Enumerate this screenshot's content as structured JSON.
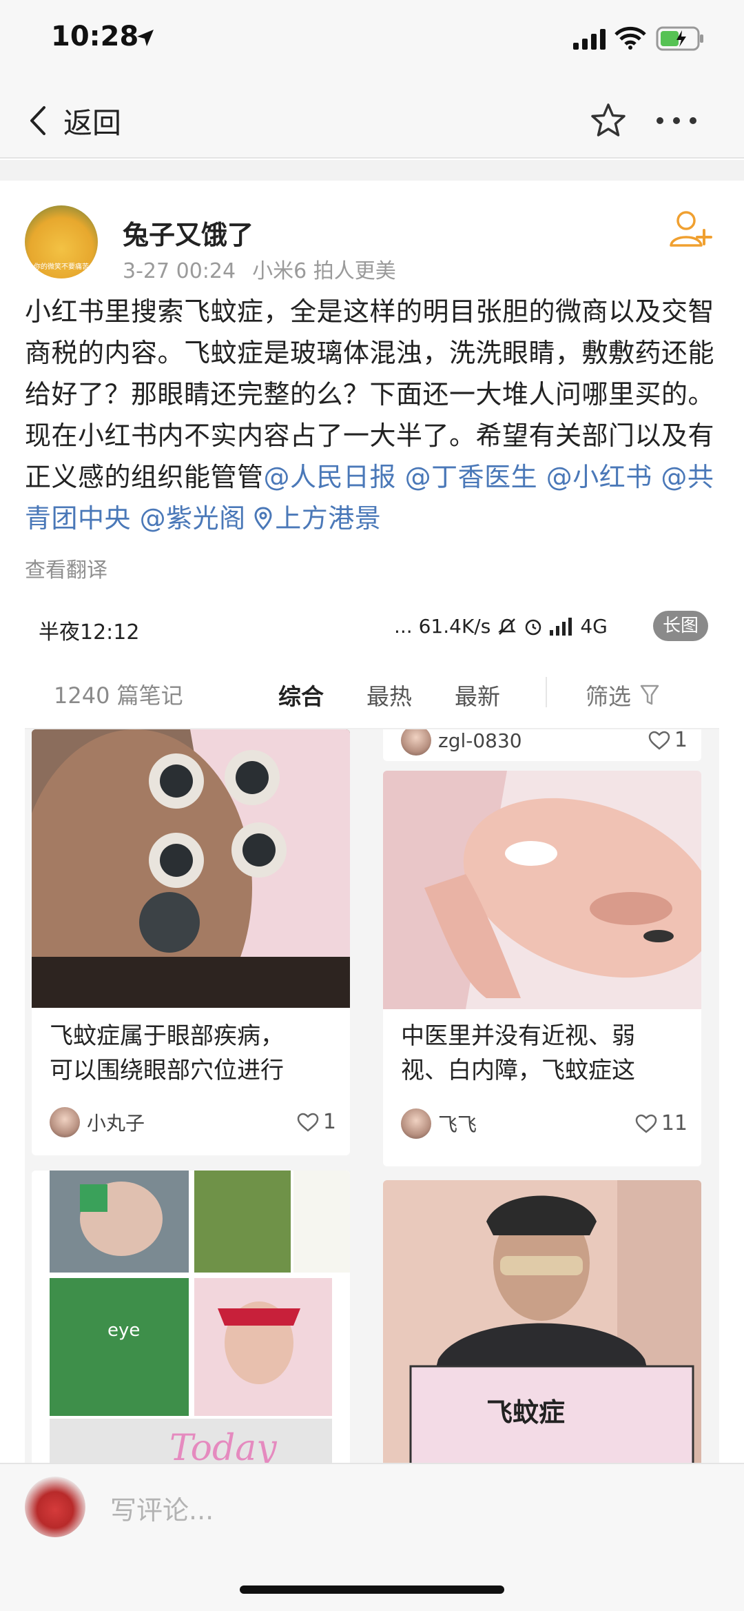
{
  "status_bar": {
    "time": "10:28"
  },
  "nav": {
    "back_label": "返回"
  },
  "post": {
    "username": "兔子又饿了",
    "avatar_caption": "你的微笑不要痛苦",
    "date": "3-27 00:24",
    "device": "小米6 拍人更美",
    "text_main": "小红书里搜索飞蚊症，全是这样的明目张胆的微商以及交智商税的内容。飞蚊症是玻璃体混浊，洗洗眼睛，敷敷药还能给好了？那眼睛还完整的么？下面还一大堆人问哪里买的。现在小红书内不实内容占了一大半了。希望有关部门以及有正义感的组织能管管",
    "mentions": [
      "@人民日报",
      "@丁香医生",
      "@小红书",
      "@共青团中央",
      "@紫光阁"
    ],
    "location": "上方港景",
    "translate": "查看翻译"
  },
  "embed": {
    "status_time": "半夜12:12",
    "network_speed": "... 61.4K/s",
    "network_type": "4G",
    "long_badge": "长图",
    "note_count": "1240 篇笔记",
    "tabs": [
      "综合",
      "最热",
      "最新"
    ],
    "filter_label": "筛选",
    "cards": [
      {
        "title_l1": "",
        "title_l2": "",
        "user": "zgl-0830",
        "likes": "1"
      },
      {
        "title_l1": "飞蚊症属于眼部疾病，",
        "title_l2": "可以围绕眼部穴位进行",
        "user": "小丸子",
        "likes": "1"
      },
      {
        "title_l1": "中医里并没有近视、弱",
        "title_l2": "视、白内障，飞蚊症这",
        "user": "飞飞",
        "likes": "11"
      },
      {
        "img_text": "eye",
        "img_text2": "Today"
      },
      {
        "img_text": "飞蚊症"
      }
    ]
  },
  "comment": {
    "placeholder": "写评论..."
  },
  "colors": {
    "link": "#4a78b8",
    "follow": "#f0a030",
    "meta": "#9a9a9a"
  }
}
